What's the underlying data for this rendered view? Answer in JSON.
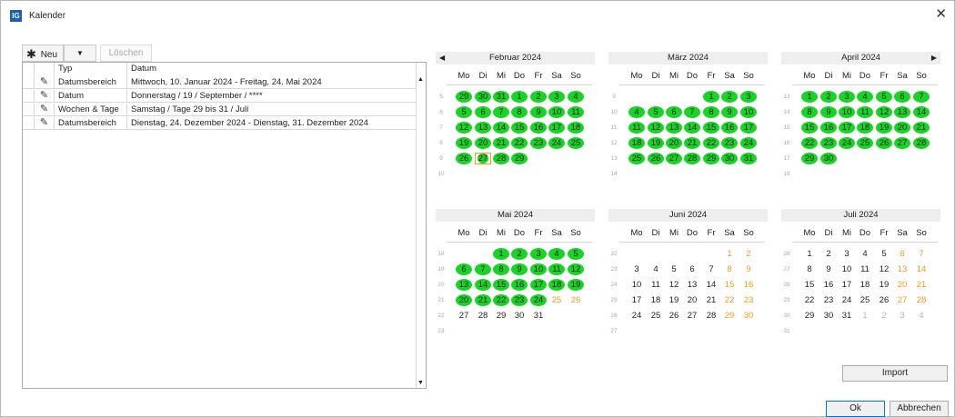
{
  "window": {
    "title": "Kalender",
    "app_icon": "IG"
  },
  "toolbar": {
    "new_label": "Neu",
    "new_icon": "✱",
    "dropdown_arrow": "▼",
    "delete_label": "Löschen"
  },
  "table": {
    "headers": [
      "Typ",
      "Datum"
    ],
    "rows": [
      {
        "type": "Datumsbereich",
        "date": "Mittwoch, 10. Januar 2024  - Freitag, 24. Mai 2024"
      },
      {
        "type": "Datum",
        "date": "Donnerstag / 19 / September / ****"
      },
      {
        "type": "Wochen & Tage",
        "date": "Samstag / Tage 29 bis 31 / Juli"
      },
      {
        "type": "Datumsbereich",
        "date": "Dienstag, 24. Dezember 2024  - Dienstag, 31. Dezember 2024"
      }
    ]
  },
  "calendar": {
    "weekdays": [
      "Mo",
      "Di",
      "Mi",
      "Do",
      "Fr",
      "Sa",
      "So"
    ],
    "months": [
      {
        "name": "Februar 2024",
        "prev": true,
        "next": false,
        "weeks": [
          5,
          6,
          7,
          8,
          9,
          10
        ],
        "lead": [
          29,
          30,
          31
        ],
        "lead_selected": true,
        "days": 29,
        "trail": [],
        "selected_through": 29,
        "today": 27
      },
      {
        "name": "März 2024",
        "prev": false,
        "next": false,
        "weeks": [
          9,
          10,
          11,
          12,
          13,
          14
        ],
        "lead": [
          26,
          27,
          28,
          29
        ],
        "lead_hidden": true,
        "days": 31,
        "trail": [],
        "selected_through": 31
      },
      {
        "name": "April 2024",
        "prev": false,
        "next": true,
        "weeks": [
          13,
          14,
          15,
          16,
          17,
          18
        ],
        "lead": [],
        "lead_hidden": true,
        "days": 30,
        "trail": [],
        "selected_through": 30
      },
      {
        "name": "Mai 2024",
        "prev": false,
        "next": false,
        "weeks": [
          18,
          19,
          20,
          21,
          22,
          23
        ],
        "lead": [
          29,
          30
        ],
        "lead_hidden": true,
        "days": 31,
        "trail": [],
        "selected_through": 24
      },
      {
        "name": "Juni 2024",
        "prev": false,
        "next": false,
        "weeks": [
          22,
          23,
          24,
          25,
          26,
          27
        ],
        "lead": [
          27,
          28,
          29,
          30,
          31
        ],
        "lead_hidden": true,
        "days": 30,
        "trail": [],
        "selected_through": 0
      },
      {
        "name": "Juli 2024",
        "prev": false,
        "next": false,
        "weeks": [
          26,
          27,
          28,
          29,
          30,
          31
        ],
        "lead": [],
        "lead_hidden": true,
        "days": 31,
        "trail": [
          1,
          2,
          3,
          4
        ],
        "selected_through": 0
      }
    ]
  },
  "buttons": {
    "import": "Import",
    "ok": "Ok",
    "cancel": "Abbrechen"
  },
  "colors": {
    "selected": "#19d426",
    "weekend": "#f29a1a",
    "accent": "#0078d7"
  }
}
